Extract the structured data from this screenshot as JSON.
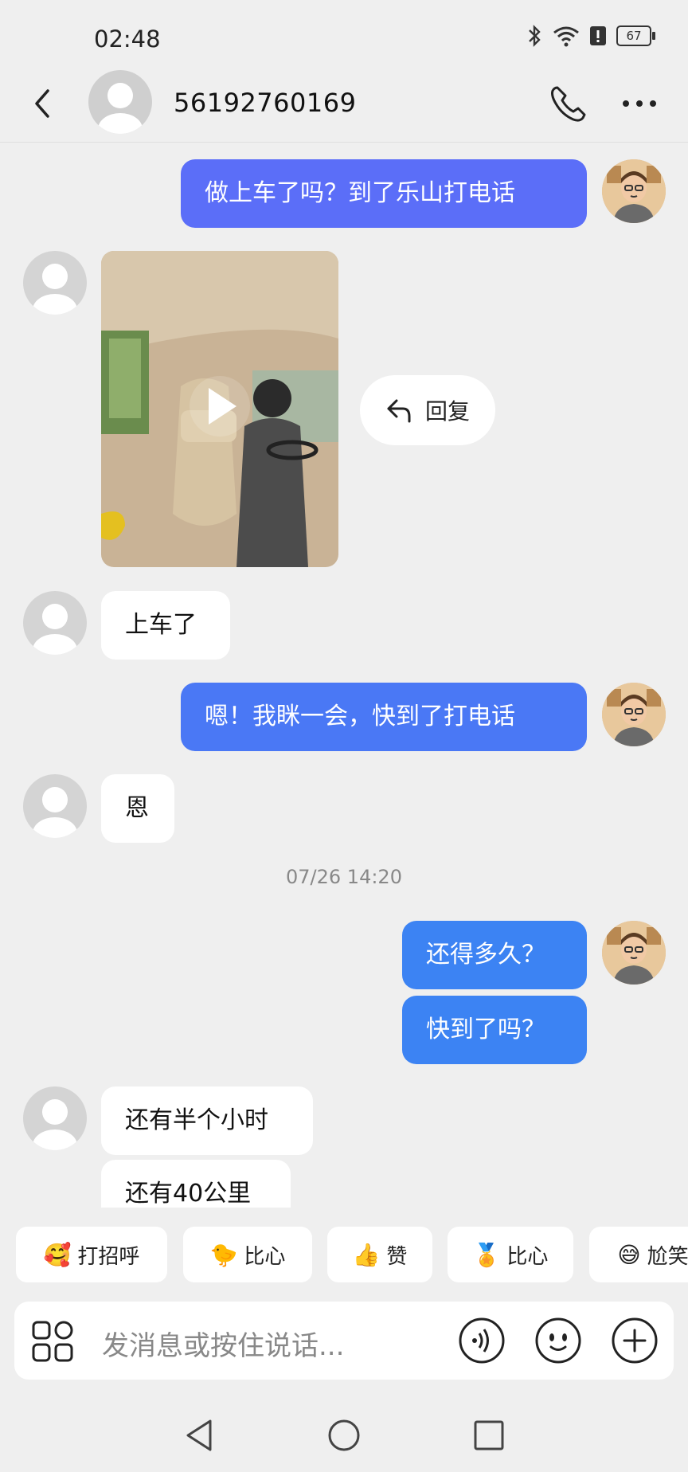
{
  "status_bar": {
    "time": "02:48",
    "battery": "67"
  },
  "header": {
    "contact_name": "56192760169"
  },
  "messages": {
    "m1": "做上车了吗？到了乐山打电话",
    "reply_label": "回复",
    "m2": "上车了",
    "m3": "嗯！我眯一会，快到了打电话",
    "m4": "恩",
    "timestamp": "07/26 14:20",
    "m5": "还得多久？",
    "m6": "快到了吗？",
    "m7": "还有半个小时",
    "m8": "还有40公里"
  },
  "quick_replies": [
    {
      "emoji": "🥰",
      "label": "打招呼"
    },
    {
      "emoji": "🐤",
      "label": "比心"
    },
    {
      "emoji": "👍",
      "label": "赞"
    },
    {
      "emoji": "🏅",
      "label": "比心"
    },
    {
      "emoji": "😅",
      "label": "尬笑"
    }
  ],
  "input": {
    "placeholder": "发消息或按住说话..."
  },
  "colors": {
    "purple_bubble": "#5b6ef8",
    "blue_bubble": "#3c83f3",
    "background": "#efefef"
  }
}
